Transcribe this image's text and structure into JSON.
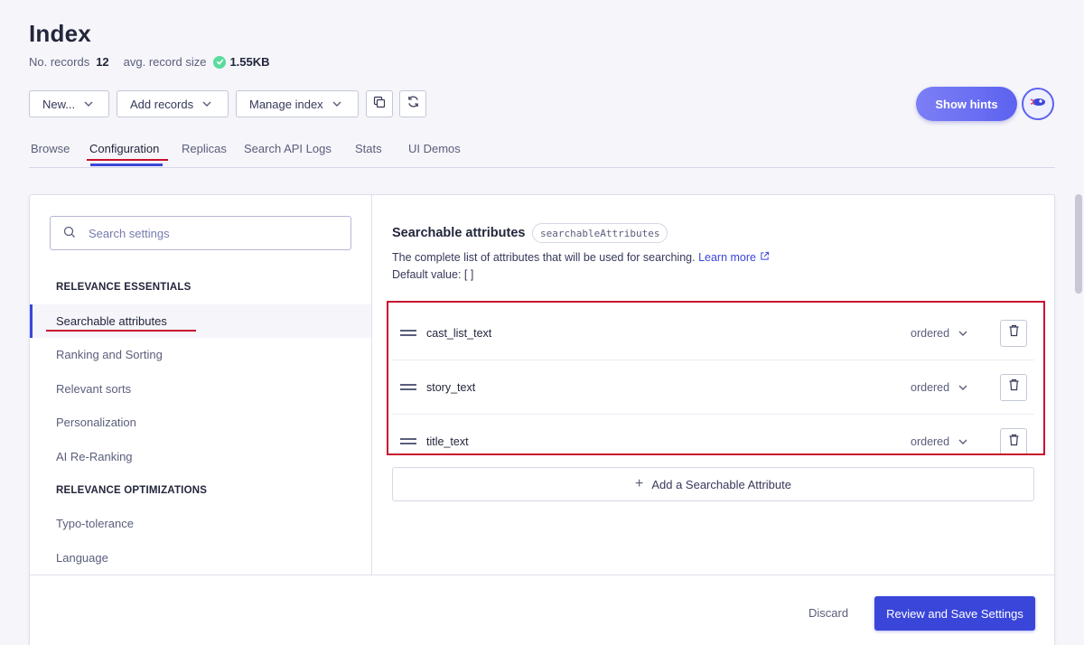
{
  "header": {
    "title": "Index",
    "records_label": "No. records",
    "records_value": "12",
    "size_label": "avg. record size",
    "size_value": "1.55KB"
  },
  "toolbar": {
    "new_label": "New...",
    "add_records_label": "Add records",
    "manage_index_label": "Manage index",
    "show_hints_label": "Show hints"
  },
  "tabs": [
    {
      "label": "Browse"
    },
    {
      "label": "Configuration"
    },
    {
      "label": "Replicas"
    },
    {
      "label": "Search API Logs"
    },
    {
      "label": "Stats"
    },
    {
      "label": "UI Demos"
    }
  ],
  "sidebar": {
    "search_placeholder": "Search settings",
    "section1": "RELEVANCE ESSENTIALS",
    "items1": [
      {
        "label": "Searchable attributes"
      },
      {
        "label": "Ranking and Sorting"
      },
      {
        "label": "Relevant sorts"
      },
      {
        "label": "Personalization"
      },
      {
        "label": "AI Re-Ranking"
      }
    ],
    "section2": "RELEVANCE OPTIMIZATIONS",
    "items2": [
      {
        "label": "Typo-tolerance"
      },
      {
        "label": "Language"
      }
    ]
  },
  "main": {
    "title": "Searchable attributes",
    "code": "searchableAttributes",
    "description": "The complete list of attributes that will be used for searching.",
    "learn_more": "Learn more",
    "default_value": "Default value: [ ]",
    "attributes": [
      {
        "name": "cast_list_text",
        "order": "ordered"
      },
      {
        "name": "story_text",
        "order": "ordered"
      },
      {
        "name": "title_text",
        "order": "ordered"
      }
    ],
    "add_label": "Add a Searchable Attribute"
  },
  "footer": {
    "discard_label": "Discard",
    "save_label": "Review and Save Settings"
  },
  "colors": {
    "accent": "#3a46d9",
    "annotation_red": "#c8102e",
    "success": "#5adc9d"
  }
}
